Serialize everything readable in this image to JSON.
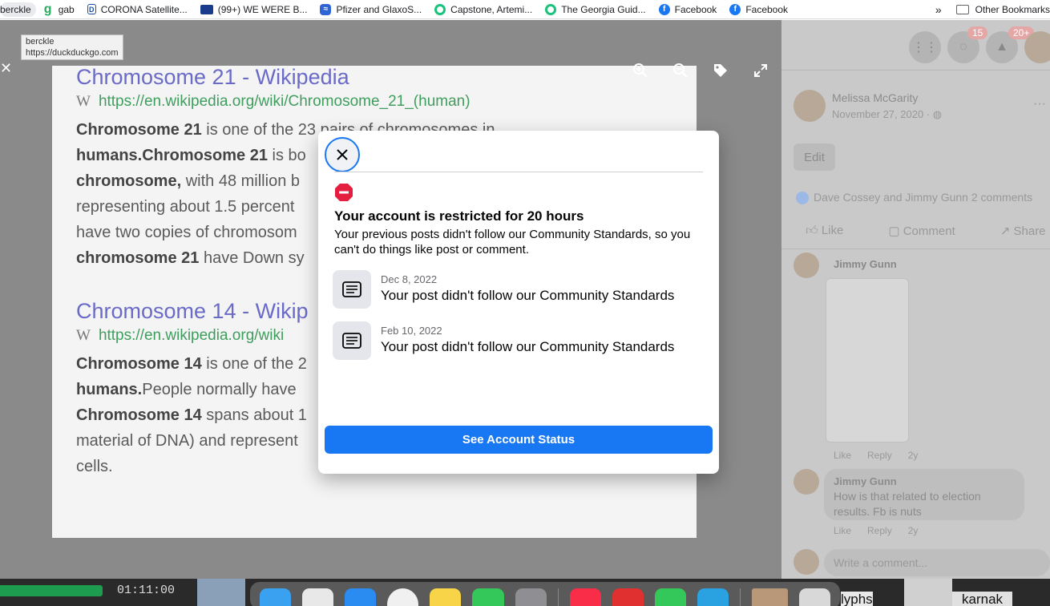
{
  "bookmarks": {
    "first_label": "berckle",
    "items": [
      {
        "label": "gab",
        "icon": "gab-icon"
      },
      {
        "label": "CORONA Satellite...",
        "icon": "corona-icon"
      },
      {
        "label": "(99+) WE WERE B...",
        "icon": "uk-flag-icon"
      },
      {
        "label": "Pfizer and GlaxoS...",
        "icon": "pfizer-icon"
      },
      {
        "label": "Capstone, Artemi...",
        "icon": "chatgpt-icon"
      },
      {
        "label": "The Georgia Guid...",
        "icon": "chatgpt-icon"
      },
      {
        "label": "Facebook",
        "icon": "facebook-icon"
      },
      {
        "label": "Facebook",
        "icon": "facebook-icon"
      }
    ],
    "overflow": "»",
    "other": "Other Bookmarks"
  },
  "tooltip": {
    "title": "berckle",
    "url": "https://duckduckgo.com"
  },
  "photo": {
    "result1_title": "Chromosome 21 - Wikipedia",
    "result1_w": "W",
    "result1_url": "https://en.wikipedia.org/wiki/Chromosome_21_(human)",
    "result1_lines": [
      {
        "b": "Chromosome 21",
        "t": " is one of the 23 pairs of chromosomes in"
      },
      {
        "b": "humans.Chromosome 21",
        "t": " is bo"
      },
      {
        "b": "chromosome,",
        "t": " with 48 million b"
      },
      {
        "b": "",
        "t": "representing about 1.5 percent"
      },
      {
        "b": "",
        "t": "have two copies of chromosom"
      },
      {
        "b": "chromosome 21",
        "t": " have Down sy"
      }
    ],
    "result2_title": "Chromosome 14 - Wikip",
    "result2_w": "W",
    "result2_url": "https://en.wikipedia.org/wiki",
    "result2_lines": [
      {
        "b": "Chromosome 14",
        "t": " is one of the 2"
      },
      {
        "b": "humans.",
        "t": "People normally have"
      },
      {
        "b": "Chromosome 14",
        "t": " spans about 1"
      },
      {
        "b": "",
        "t": "material of DNA) and represent"
      },
      {
        "b": "",
        "t": "cells."
      }
    ]
  },
  "right_panel": {
    "badge_messenger": "15",
    "badge_notifications": "20+",
    "author": "Melissa McGarity",
    "date": "November 27, 2020 ·",
    "edit_label": "Edit",
    "reactions": "Dave Cossey and Jimmy Gunn   2 comments",
    "actions": {
      "like": "Like",
      "comment": "Comment",
      "share": "Share"
    },
    "comment1_name": "Jimmy Gunn",
    "comment1_meta": {
      "like": "Like",
      "reply": "Reply",
      "age": "2y"
    },
    "comment2_name": "Jimmy Gunn",
    "comment2_text": "How is that related to election results. Fb is nuts",
    "comment2_meta": {
      "like": "Like",
      "reply": "Reply",
      "age": "2y"
    },
    "write_placeholder": "Write a comment..."
  },
  "modal": {
    "title": "Your account is restricted for 20 hours",
    "text": "Your previous posts didn't follow our Community Standards, so you can't do things like post or comment.",
    "violations": [
      {
        "date": "Dec 8, 2022",
        "text": "Your post didn't follow our Community Standards"
      },
      {
        "date": "Feb 10, 2022",
        "text": "Your post didn't follow our Community Standards"
      }
    ],
    "button": "See Account Status",
    "colors": {
      "primary": "#1877f2",
      "stop": "#e41e3f"
    }
  },
  "taskbar": {
    "timer": "01:11:00",
    "progress": 0.17,
    "left_text": "lyphs",
    "right_text": "karnak"
  }
}
